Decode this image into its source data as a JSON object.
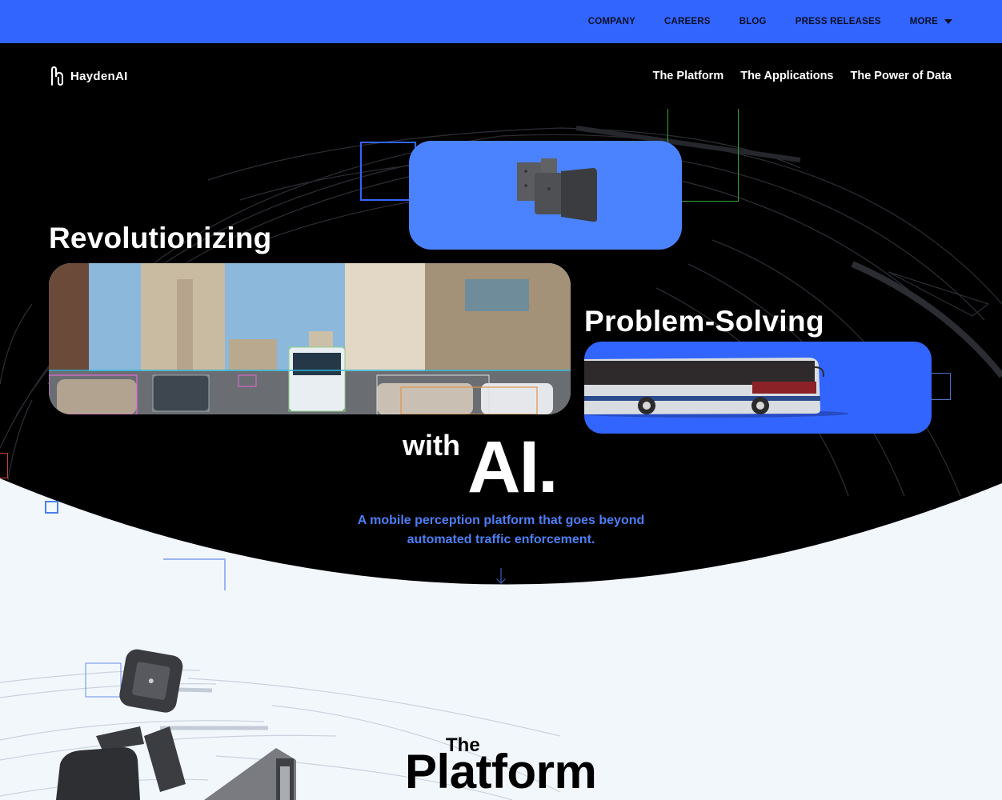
{
  "utility_nav": {
    "items": [
      {
        "label": "COMPANY"
      },
      {
        "label": "CAREERS"
      },
      {
        "label": "BLOG"
      },
      {
        "label": "PRESS RELEASES"
      },
      {
        "label": "MORE",
        "icon": "caret-down-icon"
      }
    ]
  },
  "main_nav": {
    "logo_text": "HaydenAI",
    "links": [
      {
        "label": "The Platform"
      },
      {
        "label": "The Applications"
      },
      {
        "label": "The Power of Data"
      }
    ]
  },
  "hero": {
    "word_1": "Revolutionizing",
    "word_2": "Problem-Solving",
    "word_3_small": "with",
    "word_3_big": "AI.",
    "tagline_line_1": "A mobile perception platform that goes beyond",
    "tagline_line_2": "automated traffic enforcement.",
    "scroll_icon": "arrow-down-icon",
    "cards": [
      {
        "name": "camera-device-image",
        "description": "Mounted camera device on blue card"
      },
      {
        "name": "street-detection-video",
        "description": "City street with AI object detection boxes"
      },
      {
        "name": "bus-image",
        "description": "City bus on blue card"
      }
    ]
  },
  "platform": {
    "title_small": "The",
    "title_big": "Platform"
  },
  "colors": {
    "brand_blue": "#3265fe",
    "card_blue": "#4b83fe",
    "hero_bg": "#000000",
    "page_bg": "#f2f7fc",
    "tagline": "#4d7ff5"
  }
}
